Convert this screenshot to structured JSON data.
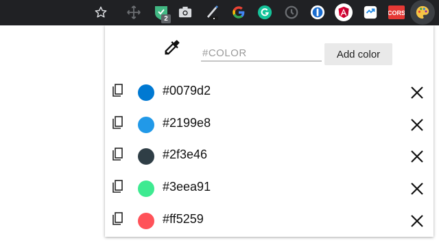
{
  "toolbar": {
    "icons": [
      "star-icon",
      "move-icon",
      "vue-devtools-icon",
      "camera-icon",
      "pen-icon",
      "google-icon",
      "grammarly-icon",
      "clock-icon",
      "one-password-icon",
      "angular-augury-icon",
      "pocket-extension-icon",
      "cors-icon",
      "color-palette-icon"
    ],
    "badge_count": "2",
    "cors_label": "CORS"
  },
  "popup": {
    "input_placeholder": "#COLOR",
    "input_value": "",
    "add_button_label": "Add color"
  },
  "colors": [
    {
      "hex": "#0079d2"
    },
    {
      "hex": "#2199e8"
    },
    {
      "hex": "#2f3e46"
    },
    {
      "hex": "#3eea91"
    },
    {
      "hex": "#ff5259"
    }
  ]
}
